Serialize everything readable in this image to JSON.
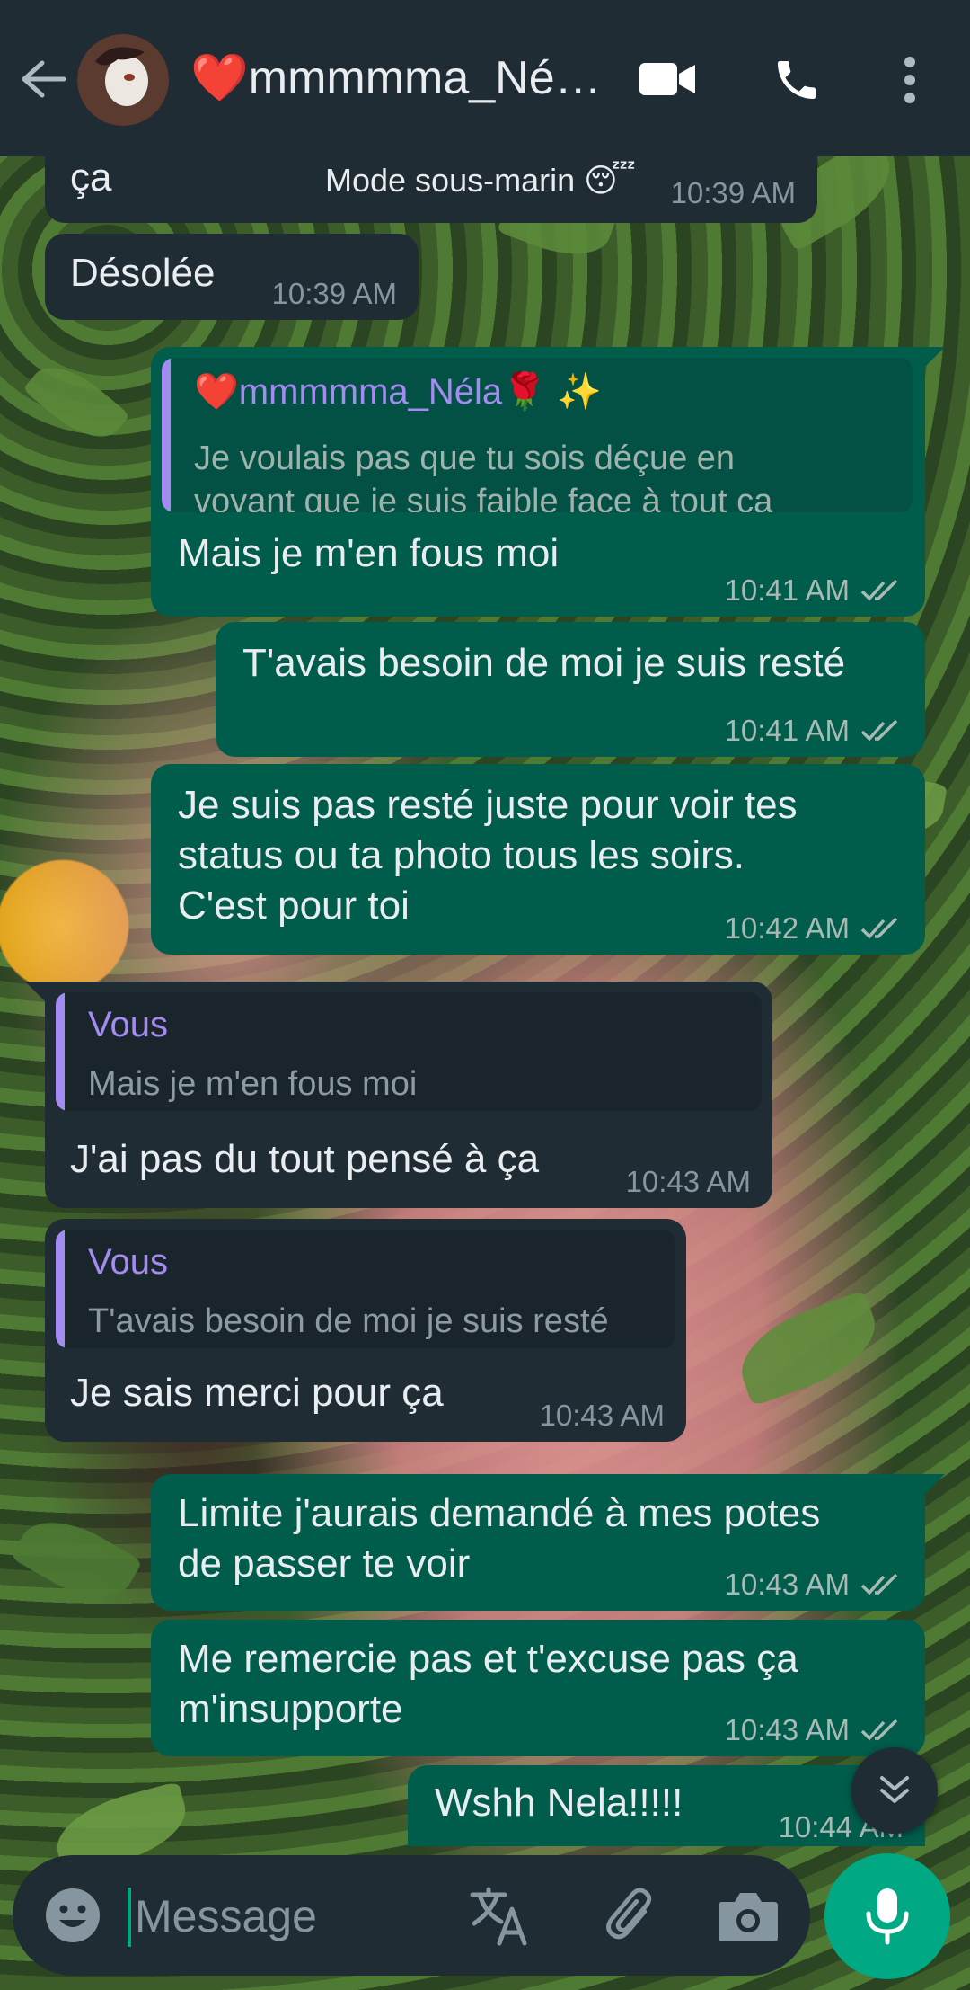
{
  "header": {
    "contact_name": "❤️mmmmma_Né…",
    "icons": [
      "back-arrow-icon",
      "video-call-icon",
      "voice-call-icon",
      "more-vert-icon"
    ]
  },
  "messages": [
    {
      "id": "m0",
      "direction": "in",
      "partial": true,
      "text": "ça",
      "caption": "Mode sous-marin 😴",
      "time": "10:39 AM"
    },
    {
      "id": "m1",
      "direction": "in",
      "text": "Désolée",
      "time": "10:39 AM"
    },
    {
      "id": "m2",
      "direction": "out",
      "quote_name": "❤️mmmmma_Néla🌹 ✨",
      "quote_line1": "Je voulais pas que tu sois déçue en",
      "quote_line2": "voyant que je suis faible face à tout ça",
      "text": "Mais je m'en fous moi",
      "time": "10:41 AM"
    },
    {
      "id": "m3",
      "direction": "out",
      "text": "T'avais besoin de moi je suis resté",
      "time": "10:41 AM"
    },
    {
      "id": "m4",
      "direction": "out",
      "line1": "Je suis pas resté juste pour voir tes",
      "line2": "status ou ta photo tous les soirs.",
      "line3": "C'est pour toi",
      "time": "10:42 AM"
    },
    {
      "id": "m5",
      "direction": "in",
      "quote_name": "Vous",
      "quote_text": "Mais je m'en fous moi",
      "text": "J'ai pas du tout pensé à ça",
      "time": "10:43 AM"
    },
    {
      "id": "m6",
      "direction": "in",
      "quote_name": "Vous",
      "quote_text": "T'avais besoin de moi je suis resté",
      "text": "Je sais merci pour ça",
      "time": "10:43 AM"
    },
    {
      "id": "m7",
      "direction": "out",
      "line1": "Limite j'aurais demandé à mes potes",
      "line2": "de passer te voir",
      "time": "10:43 AM"
    },
    {
      "id": "m8",
      "direction": "out",
      "line1": "Me remercie pas et t'excuse pas ça",
      "line2": "m'insupporte",
      "time": "10:43 AM"
    },
    {
      "id": "m9",
      "direction": "out",
      "text": "Wshh Nela!!!!!",
      "time": "10:44 AM"
    }
  ],
  "composer": {
    "placeholder": "Message",
    "icons": [
      "emoji-icon",
      "translate-icon",
      "attach-icon",
      "camera-icon",
      "mic-icon"
    ]
  },
  "colors": {
    "header_bg": "#1f2c34",
    "incoming_bubble": "#1f2c34",
    "outgoing_bubble": "#005c4b",
    "quote_accent": "#a48bf2",
    "mic_button": "#00a884",
    "read_ticks": "#a9b9b4"
  }
}
